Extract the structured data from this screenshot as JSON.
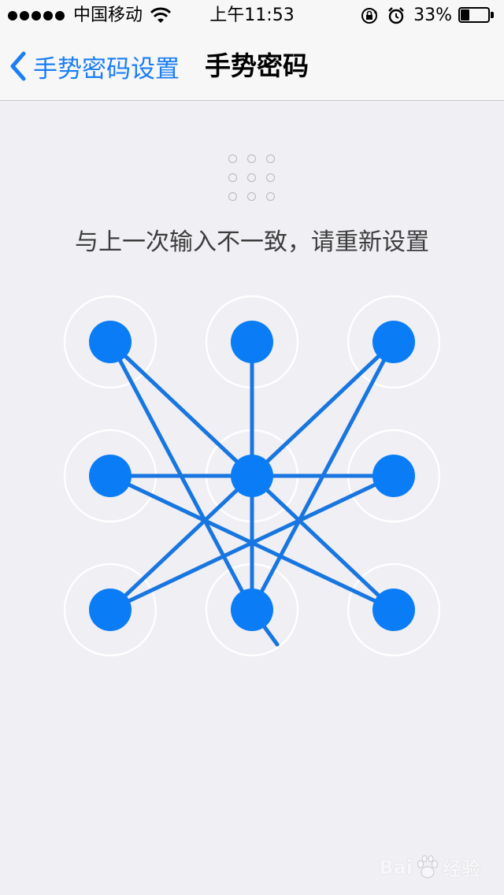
{
  "status_bar": {
    "carrier": "中国移动",
    "time": "上午11:53",
    "battery_percent": "33%",
    "battery_level": 0.33,
    "signal_bars": 5,
    "icons": [
      "wifi-icon",
      "rotation-lock-icon",
      "alarm-icon",
      "battery-icon"
    ]
  },
  "nav": {
    "back_label": "手势密码设置",
    "title": "手势密码"
  },
  "message": "与上一次输入不一致，请重新设置",
  "pattern": {
    "rows": 3,
    "cols": 3,
    "accent_color": "#0a7cf5",
    "line_color": "#1876e0",
    "ring_color": "#ffffff",
    "selected": [
      1,
      2,
      3,
      4,
      5,
      6,
      7,
      8,
      9
    ],
    "segments": [
      [
        1,
        8
      ],
      [
        2,
        5
      ],
      [
        3,
        5
      ],
      [
        3,
        8
      ],
      [
        4,
        6
      ],
      [
        4,
        9
      ],
      [
        5,
        7
      ],
      [
        5,
        9
      ],
      [
        6,
        7
      ],
      [
        2,
        8
      ],
      [
        1,
        5
      ]
    ],
    "trail_from": 8
  },
  "watermark": {
    "brand_left": "Bai",
    "brand_right": "经验",
    "icon": "baidu-paw-icon"
  }
}
